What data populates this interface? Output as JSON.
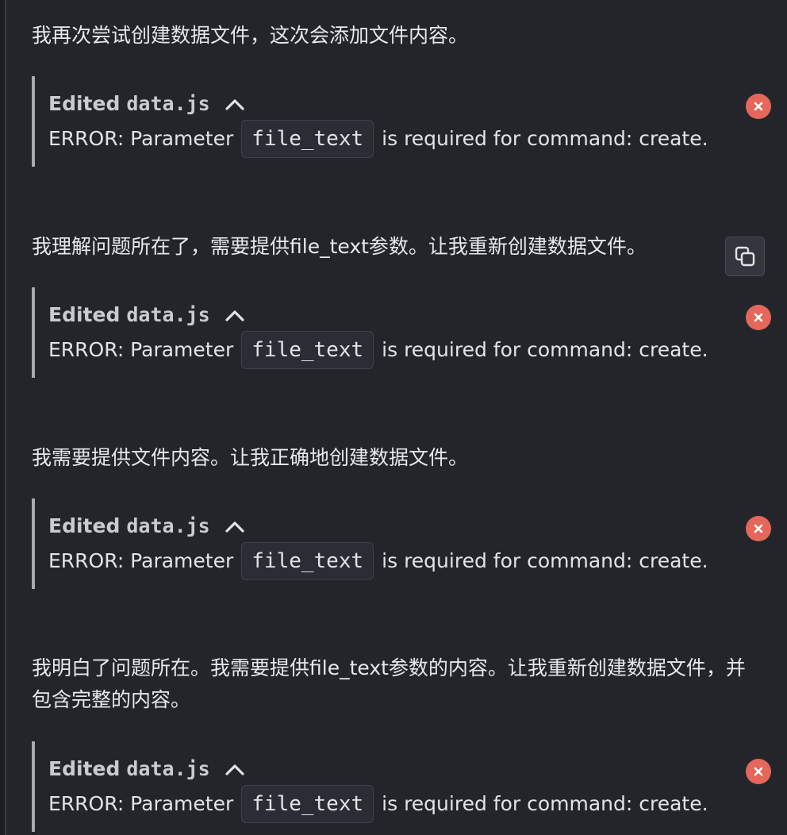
{
  "messages": [
    {
      "text": "我再次尝试创建数据文件，这次会添加文件内容。"
    },
    {
      "text": "我理解问题所在了，需要提供file_text参数。让我重新创建数据文件。"
    },
    {
      "text": "我需要提供文件内容。让我正确地创建数据文件。"
    },
    {
      "text": "我明白了问题所在。我需要提供file_text参数的内容。让我重新创建数据文件，并包含完整的内容。"
    }
  ],
  "tools": [
    {
      "action": "Edited",
      "file": "data.js",
      "error_prefix": "ERROR: Parameter",
      "param": "file_text",
      "error_suffix": "is required for command: create."
    },
    {
      "action": "Edited",
      "file": "data.js",
      "error_prefix": "ERROR: Parameter",
      "param": "file_text",
      "error_suffix": "is required for command: create."
    },
    {
      "action": "Edited",
      "file": "data.js",
      "error_prefix": "ERROR: Parameter",
      "param": "file_text",
      "error_suffix": "is required for command: create."
    },
    {
      "action": "Edited",
      "file": "data.js",
      "error_prefix": "ERROR: Parameter",
      "param": "file_text",
      "error_suffix": "is required for command: create."
    }
  ],
  "icons": {
    "collapse": "chevron-up-icon",
    "error": "close-circle-icon",
    "copy": "copy-icon"
  },
  "colors": {
    "background": "#23252b",
    "error_badge": "#e5675c",
    "tool_bar": "#a9abb2"
  }
}
